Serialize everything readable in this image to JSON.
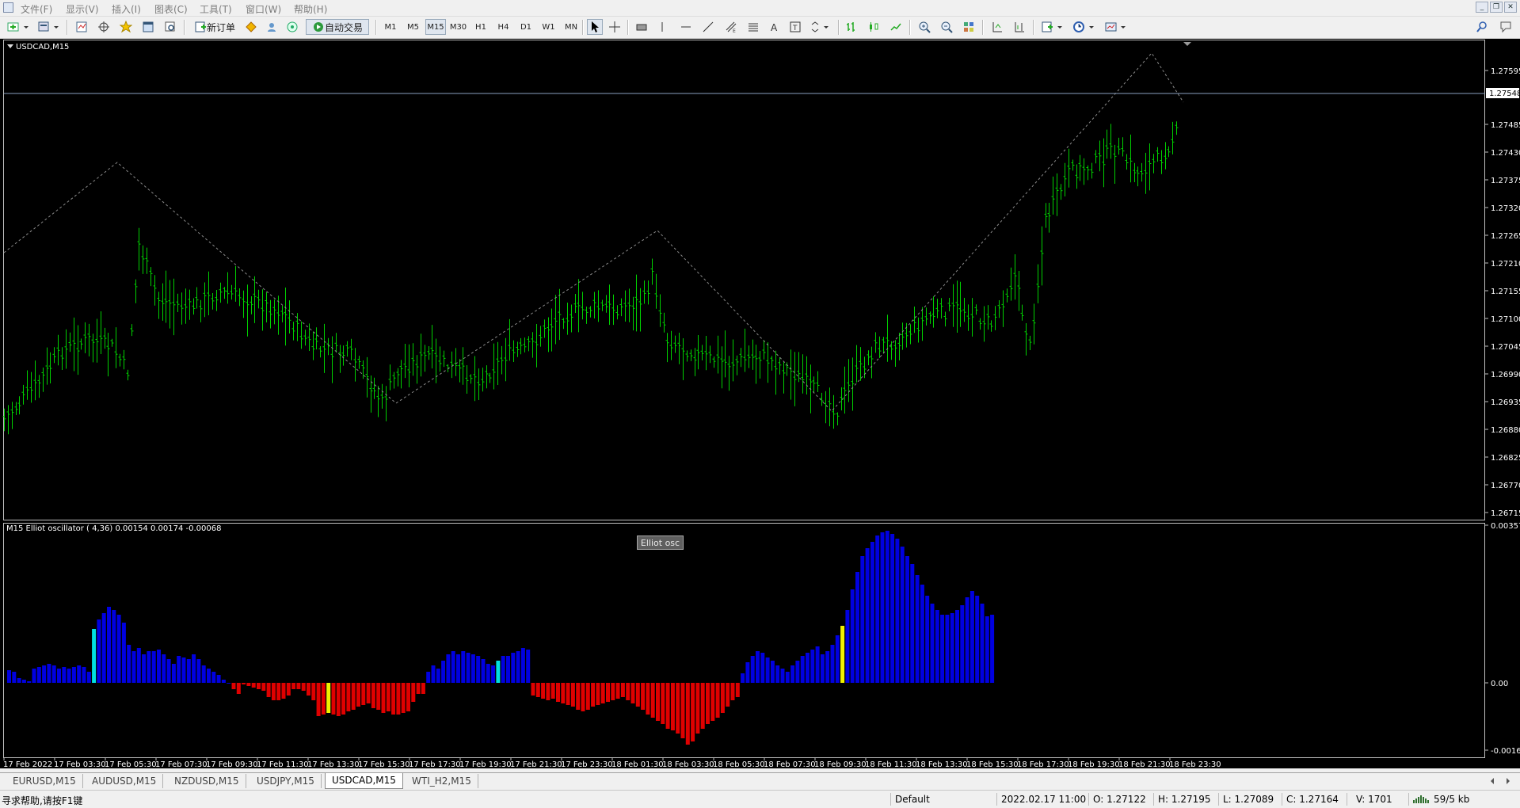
{
  "menu": [
    "文件(F)",
    "显示(V)",
    "插入(I)",
    "图表(C)",
    "工具(T)",
    "窗口(W)",
    "帮助(H)"
  ],
  "toolbar": {
    "new_order": "新订单",
    "auto_trade": "自动交易",
    "timeframes": [
      "M1",
      "M5",
      "M15",
      "M30",
      "H1",
      "H4",
      "D1",
      "W1",
      "MN"
    ],
    "active_timeframe": "M15"
  },
  "main_chart": {
    "title": "USDCAD,M15",
    "price_ticks": [
      "1.27595",
      "1.27485",
      "1.27430",
      "1.27375",
      "1.27320",
      "1.27265",
      "1.27210",
      "1.27155",
      "1.27100",
      "1.27045",
      "1.26990",
      "1.26935",
      "1.26880",
      "1.26825",
      "1.26770",
      "1.26715"
    ],
    "current_price": "1.27548",
    "bar_color": "#00d000",
    "zigzag_color": "#888888"
  },
  "oscillator": {
    "title": "M15 Elliot oscillator ( 4,36) 0.00154 0.00174 -0.00068",
    "button_label": "Elliot osc",
    "ticks": [
      "0.00357",
      "0.00",
      "-0.00161"
    ],
    "colors": {
      "up": "#0000e0",
      "down": "#e00000",
      "peak": "#00e0e0",
      "trough": "#f0f000"
    }
  },
  "time_axis": [
    "17 Feb 2022",
    "17 Feb 03:30",
    "17 Feb 05:30",
    "17 Feb 07:30",
    "17 Feb 09:30",
    "17 Feb 11:30",
    "17 Feb 13:30",
    "17 Feb 15:30",
    "17 Feb 17:30",
    "17 Feb 19:30",
    "17 Feb 21:30",
    "17 Feb 23:30",
    "18 Feb 01:30",
    "18 Feb 03:30",
    "18 Feb 05:30",
    "18 Feb 07:30",
    "18 Feb 09:30",
    "18 Feb 11:30",
    "18 Feb 13:30",
    "18 Feb 15:30",
    "18 Feb 17:30",
    "18 Feb 19:30",
    "18 Feb 21:30",
    "18 Feb 23:30"
  ],
  "tabs": [
    "EURUSD,M15",
    "AUDUSD,M15",
    "NZDUSD,M15",
    "USDJPY,M15",
    "USDCAD,M15",
    "WTI_H2,M15"
  ],
  "active_tab": "USDCAD,M15",
  "status": {
    "help": "寻求帮助,请按F1键",
    "profile": "Default",
    "datetime": "2022.02.17 11:00",
    "open": "O: 1.27122",
    "high": "H: 1.27195",
    "low": "L: 1.27089",
    "close": "C: 1.27164",
    "volume": "V: 1701",
    "traffic": "59/5 kb"
  }
}
